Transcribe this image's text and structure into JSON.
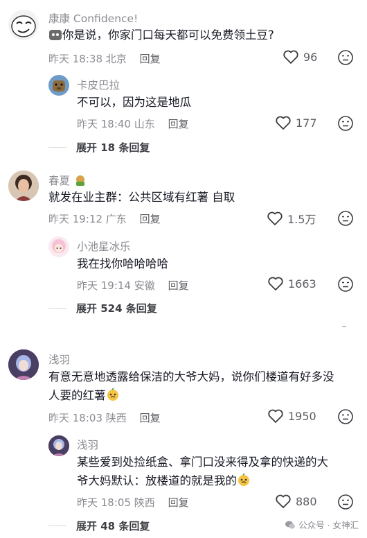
{
  "comments": [
    {
      "name": "康康 Confidence!",
      "text": "你是说，你家门口每天都可以免费领土豆?",
      "date": "昨天 18:38",
      "location": "北京",
      "reply_label": "回复",
      "likes": "96",
      "replies": [
        {
          "name": "卡皮巴拉",
          "text": "不可以，因为这是地瓜",
          "date": "昨天 18:40",
          "location": "山东",
          "reply_label": "回复",
          "likes": "177"
        }
      ],
      "expand_label": "展开 18 条回复"
    },
    {
      "name": "春夏",
      "text": "就发在业主群：公共区域有红薯 自取",
      "date": "昨天 19:12",
      "location": "广东",
      "reply_label": "回复",
      "likes": "1.5万",
      "replies": [
        {
          "name": "小池星冰乐",
          "text": "我在找你哈哈哈哈",
          "date": "昨天 19:14",
          "location": "安徽",
          "reply_label": "回复",
          "likes": "1663"
        }
      ],
      "expand_label": "展开 524 条回复"
    },
    {
      "name": "浅羽",
      "text_line1": "有意无意地透露给保洁的大爷大妈，说你们楼道有好多没",
      "text_line2": "人要的红薯",
      "date": "昨天 18:03",
      "location": "陕西",
      "reply_label": "回复",
      "likes": "1950",
      "replies": [
        {
          "name": "浅羽",
          "text_line1": "某些爱到处捡纸盒、拿门口没来得及拿的快递的大",
          "text_line2": "爷大妈默认：放楼道的就是我的",
          "date": "昨天 18:05",
          "location": "陕西",
          "reply_label": "回复",
          "likes": "880"
        }
      ],
      "expand_label": "展开 48 条回复"
    }
  ],
  "watermark": "公众号 · 女神汇",
  "icons": {
    "like": "heart-outline-icon",
    "dislike": "unhappy-face-icon",
    "wechat": "wechat-logo-icon"
  }
}
